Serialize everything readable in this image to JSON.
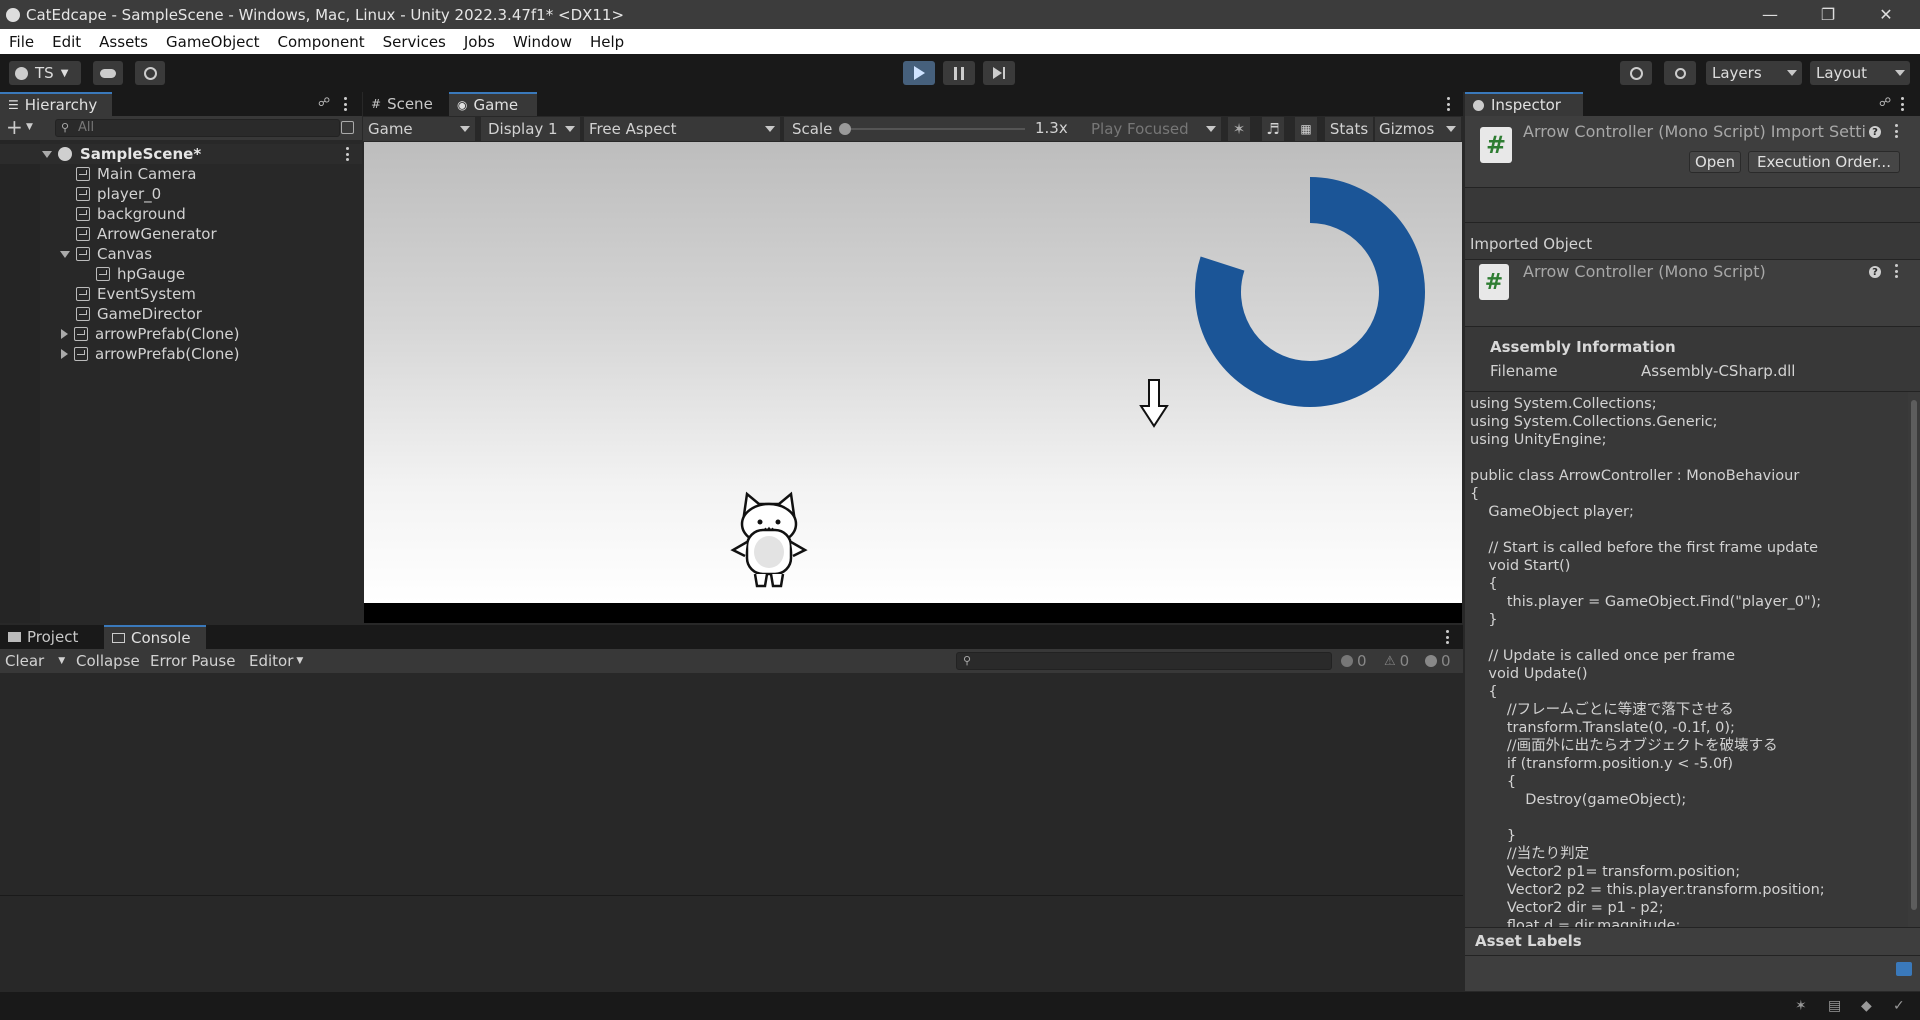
{
  "window": {
    "title": "CatEdcape - SampleScene - Windows, Mac, Linux - Unity 2022.3.47f1* <DX11>"
  },
  "menu": [
    "File",
    "Edit",
    "Assets",
    "GameObject",
    "Component",
    "Services",
    "Jobs",
    "Window",
    "Help"
  ],
  "toolbar": {
    "account": "TS",
    "layers": "Layers",
    "layout": "Layout"
  },
  "hierarchy": {
    "tab": "Hierarchy",
    "search_placeholder": "All",
    "scene": "SampleScene*",
    "items": [
      {
        "label": "Main Camera"
      },
      {
        "label": "player_0"
      },
      {
        "label": "background"
      },
      {
        "label": "ArrowGenerator"
      },
      {
        "label": "Canvas"
      },
      {
        "label": "hpGauge"
      },
      {
        "label": "EventSystem"
      },
      {
        "label": "GameDirector"
      },
      {
        "label": "arrowPrefab(Clone)"
      },
      {
        "label": "arrowPrefab(Clone)"
      }
    ]
  },
  "game_view": {
    "tabs": [
      "Scene",
      "Game"
    ],
    "mode": "Game",
    "display": "Display 1",
    "aspect": "Free Aspect",
    "scale_label": "Scale",
    "scale_value": "1.3x",
    "play_mode": "Play Focused",
    "stats": "Stats",
    "gizmos": "Gizmos",
    "hp_gauge_fill": 0.8,
    "hp_color": "#1b5597"
  },
  "console": {
    "tabs": [
      "Project",
      "Console"
    ],
    "clear": "Clear",
    "collapse": "Collapse",
    "error_pause": "Error Pause",
    "editor": "Editor",
    "log_count": "0",
    "warn_count": "0",
    "error_count": "0"
  },
  "inspector": {
    "tab": "Inspector",
    "header_title": "Arrow Controller (Mono Script) Import Setti",
    "open_button": "Open",
    "exec_order_button": "Execution Order...",
    "imported_object": "Imported Object",
    "script_title": "Arrow Controller (Mono Script)",
    "assembly_heading": "Assembly Information",
    "filename_label": "Filename",
    "filename_value": "Assembly-CSharp.dll",
    "code": "using System.Collections;\nusing System.Collections.Generic;\nusing UnityEngine;\n\npublic class ArrowController : MonoBehaviour\n{\n    GameObject player;\n\n    // Start is called before the first frame update\n    void Start()\n    {\n        this.player = GameObject.Find(\"player_0\");\n    }\n\n    // Update is called once per frame\n    void Update()\n    {\n        //フレームごとに等速で落下させる\n        transform.Translate(0, -0.1f, 0);\n        //画面外に出たらオブジェクトを破壊する\n        if (transform.position.y < -5.0f)\n        {\n            Destroy(gameObject);\n\n        }\n        //当たり判定\n        Vector2 p1= transform.position;\n        Vector2 p2 = this.player.transform.position;\n        Vector2 dir = p1 - p2;\n        float d = dir.magnitude;",
    "asset_labels": "Asset Labels"
  }
}
